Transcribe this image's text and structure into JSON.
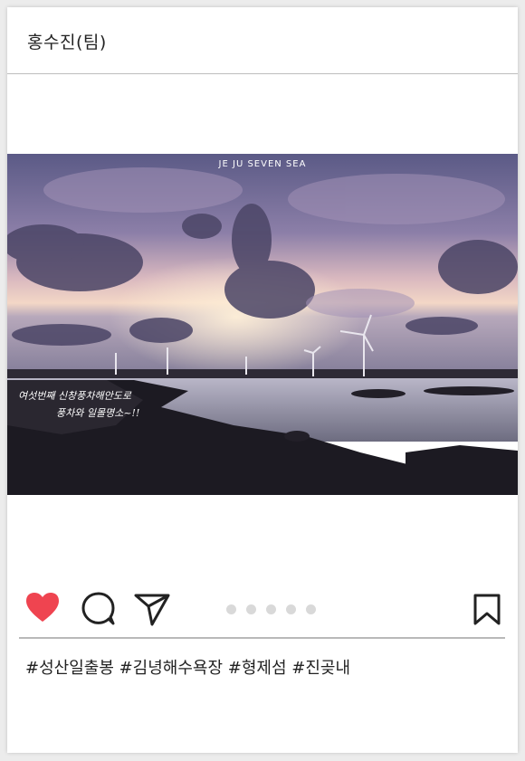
{
  "post": {
    "username": "홍수진(팀)",
    "image": {
      "top_caption": "JE JU SEVEN SEA",
      "handwritten_line1": "여섯번째 신창풍차해안도로",
      "handwritten_line2": "풍차와 일몰명소~!!"
    },
    "actions": {
      "like_icon": "heart-filled-icon",
      "comment_icon": "speech-bubble-icon",
      "share_icon": "paper-plane-icon",
      "bookmark_icon": "bookmark-icon",
      "carousel_dots": 5
    },
    "hashtags": "#성산일출봉 #김녕해수욕장 #형제섬 #진곶내"
  },
  "colors": {
    "like": "#ef4450",
    "icon_stroke": "#222222",
    "dot": "#d9d9d9",
    "divider": "#b9b9b9"
  }
}
